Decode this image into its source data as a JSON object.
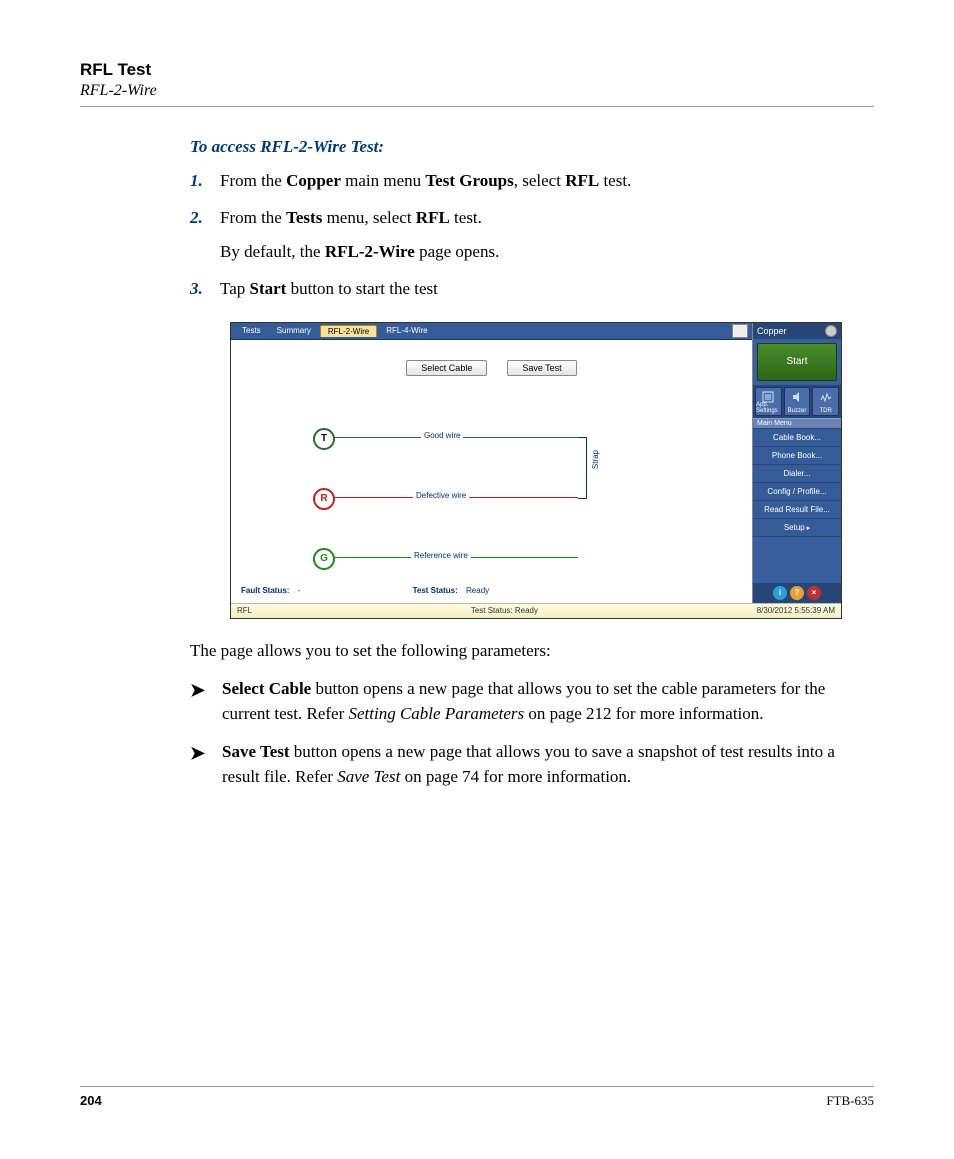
{
  "header": {
    "title": "RFL Test",
    "subtitle": "RFL-2-Wire"
  },
  "instructions": {
    "heading": "To access RFL-2-Wire Test:",
    "steps": [
      {
        "n": "1.",
        "parts": [
          "From the ",
          "Copper",
          " main menu ",
          "Test Groups",
          ", select ",
          "RFL",
          " test."
        ]
      },
      {
        "n": "2.",
        "parts": [
          "From the ",
          "Tests",
          " menu, select ",
          "RFL",
          " test."
        ],
        "sub": [
          "By default, the ",
          "RFL-2-Wire",
          " page opens."
        ]
      },
      {
        "n": "3.",
        "parts": [
          "Tap ",
          "Start",
          " button to start the test"
        ]
      }
    ]
  },
  "screenshot": {
    "tabs": [
      "Tests",
      "Summary",
      "RFL-2-Wire",
      "RFL-4-Wire"
    ],
    "active_tab": 2,
    "buttons": {
      "select_cable": "Select Cable",
      "save_test": "Save Test"
    },
    "wires": {
      "t": {
        "letter": "T",
        "label": "Good wire",
        "border": "#2a6b2a",
        "color": "#2a6b2a"
      },
      "r": {
        "letter": "R",
        "label": "Defective wire",
        "border": "#c02020",
        "color": "#c02020"
      },
      "g": {
        "letter": "G",
        "label": "Reference wire",
        "border": "#1a8a1a",
        "color": "#1a8a1a"
      }
    },
    "strap": "Strap",
    "fault_status_label": "Fault Status:",
    "fault_status_value": "-",
    "test_status_label": "Test Status:",
    "test_status_value": "Ready",
    "side": {
      "title": "Copper",
      "start": "Start",
      "mini": [
        "App. Settings",
        "Buzzer",
        "TDR"
      ],
      "menu_header": "Main Menu",
      "menu": [
        "Cable Book...",
        "Phone Book...",
        "Dialer...",
        "Config / Profile...",
        "Read Result File...",
        "Setup"
      ]
    },
    "footer": {
      "left": "RFL",
      "center": "Test Status: Ready",
      "right": "8/30/2012 5:55:39 AM"
    }
  },
  "after": "The page allows you to set the following parameters:",
  "bullets": [
    {
      "segments": [
        {
          "t": "Select Cable",
          "b": true
        },
        {
          "t": " button opens a new page that allows you to set the cable parameters for the current test. Refer "
        },
        {
          "t": "Setting Cable Parameters",
          "i": true
        },
        {
          "t": " on page 212 for more information."
        }
      ]
    },
    {
      "segments": [
        {
          "t": "Save Test",
          "b": true
        },
        {
          "t": " button opens a new page that allows you to save a snapshot of test results into a result file. Refer "
        },
        {
          "t": "Save Test",
          "i": true
        },
        {
          "t": " on page 74 for more information."
        }
      ]
    }
  ],
  "footer": {
    "page": "204",
    "doc": "FTB-635"
  }
}
